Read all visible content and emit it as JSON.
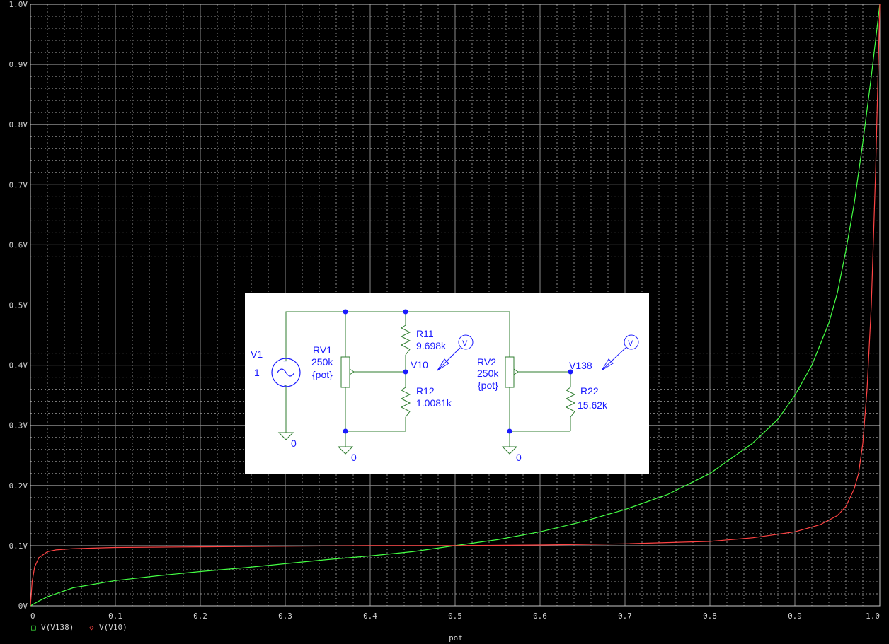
{
  "chart_data": {
    "type": "line",
    "xlabel": "pot",
    "ylabel": "",
    "xlim": [
      0,
      1
    ],
    "ylim": [
      0,
      1
    ],
    "grid": true,
    "x_ticks": [
      "0",
      "0.1",
      "0.2",
      "0.3",
      "0.4",
      "0.5",
      "0.6",
      "0.7",
      "0.8",
      "0.9",
      "1.0"
    ],
    "y_ticks": [
      "0V",
      "0.1V",
      "0.2V",
      "0.3V",
      "0.4V",
      "0.5V",
      "0.6V",
      "0.7V",
      "0.8V",
      "0.9V",
      "1.0V"
    ],
    "legend_position": "bottom-left",
    "series": [
      {
        "name": "V(V138)",
        "color": "#44ff44",
        "marker": "□",
        "x": [
          0,
          0.01,
          0.02,
          0.05,
          0.1,
          0.15,
          0.2,
          0.25,
          0.3,
          0.35,
          0.4,
          0.45,
          0.5,
          0.55,
          0.6,
          0.65,
          0.7,
          0.75,
          0.8,
          0.85,
          0.88,
          0.9,
          0.92,
          0.94,
          0.95,
          0.96,
          0.97,
          0.98,
          0.99,
          1.0
        ],
        "values": [
          0,
          0.008,
          0.015,
          0.03,
          0.042,
          0.05,
          0.057,
          0.063,
          0.07,
          0.077,
          0.083,
          0.09,
          0.1,
          0.11,
          0.123,
          0.14,
          0.16,
          0.185,
          0.22,
          0.27,
          0.31,
          0.35,
          0.4,
          0.47,
          0.52,
          0.59,
          0.67,
          0.77,
          0.88,
          1.0
        ]
      },
      {
        "name": "V(V10)",
        "color": "#ff4444",
        "marker": "◇",
        "x": [
          0,
          0.002,
          0.005,
          0.01,
          0.02,
          0.03,
          0.05,
          0.1,
          0.2,
          0.3,
          0.4,
          0.5,
          0.6,
          0.7,
          0.8,
          0.85,
          0.9,
          0.93,
          0.95,
          0.96,
          0.97,
          0.975,
          0.98,
          0.985,
          0.99,
          0.995,
          1.0
        ],
        "values": [
          0,
          0.04,
          0.065,
          0.08,
          0.09,
          0.093,
          0.095,
          0.097,
          0.098,
          0.099,
          0.1,
          0.1,
          0.101,
          0.103,
          0.107,
          0.113,
          0.123,
          0.135,
          0.15,
          0.165,
          0.195,
          0.22,
          0.27,
          0.36,
          0.5,
          0.72,
          1.0
        ]
      }
    ]
  },
  "schematic": {
    "v1_name": "V1",
    "v1_value": "1",
    "v1_plus": "+",
    "v1_minus": "-",
    "rv1_name": "RV1",
    "rv1_value": "250k",
    "rv1_param": "{pot}",
    "r11_name": "R11",
    "r11_value": "9.698k",
    "r12_name": "R12",
    "r12_value": "1.0081k",
    "v10_label": "V10",
    "rv2_name": "RV2",
    "rv2_value": "250k",
    "rv2_param": "{pot}",
    "v138_label": "V138",
    "r22_name": "R22",
    "r22_value": "15.62k",
    "probe_label": "V",
    "ground_label": "0"
  }
}
